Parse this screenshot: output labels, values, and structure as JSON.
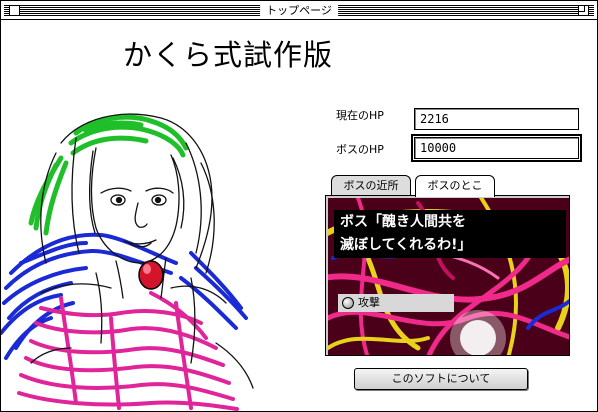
{
  "window": {
    "title": "トップページ"
  },
  "app": {
    "title": "かくら式試作版"
  },
  "fields": {
    "current_hp_label": "現在のHP",
    "current_hp_value": "2216",
    "boss_hp_label": "ボスのHP",
    "boss_hp_value": "10000"
  },
  "tabs": [
    {
      "label": "ボスの近所"
    },
    {
      "label": "ボスのとこ"
    }
  ],
  "active_tab": "ボスのとこ",
  "boss_panel": {
    "speech_line1": "ボス「醜き人間共を",
    "speech_line2": "滅ぼしてくれるわ!」",
    "attack_label": "攻撃"
  },
  "buttons": {
    "about_label": "このソフトについて"
  },
  "icons": [
    "close-box-icon",
    "zoom-box-icon",
    "radio-icon"
  ]
}
